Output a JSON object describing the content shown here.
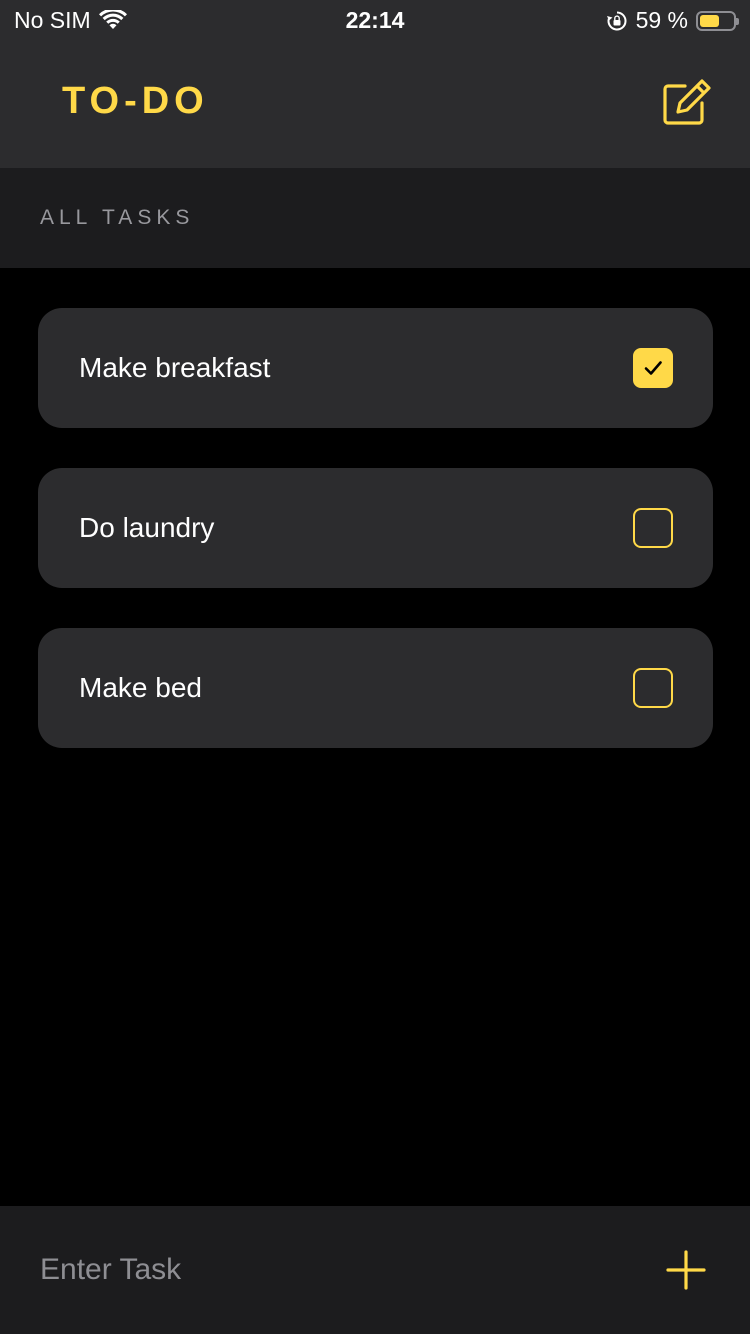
{
  "status_bar": {
    "carrier": "No SIM",
    "time": "22:14",
    "battery_percent_label": "59 %",
    "battery_level": 0.59,
    "icons": [
      "wifi-icon",
      "rotation-lock-icon",
      "battery-icon"
    ]
  },
  "header": {
    "title": "TO-DO",
    "action_icon": "compose-icon"
  },
  "section": {
    "title": "ALL TASKS"
  },
  "tasks": [
    {
      "label": "Make breakfast",
      "done": true
    },
    {
      "label": "Do laundry",
      "done": false
    },
    {
      "label": "Make bed",
      "done": false
    }
  ],
  "input": {
    "placeholder": "Enter Task",
    "value": "",
    "add_icon": "plus-icon"
  },
  "colors": {
    "accent": "#ffd948",
    "bar_background": "#2c2c2e",
    "section_background": "#1c1c1e",
    "page_background": "#000000",
    "secondary_text": "#98989d"
  }
}
